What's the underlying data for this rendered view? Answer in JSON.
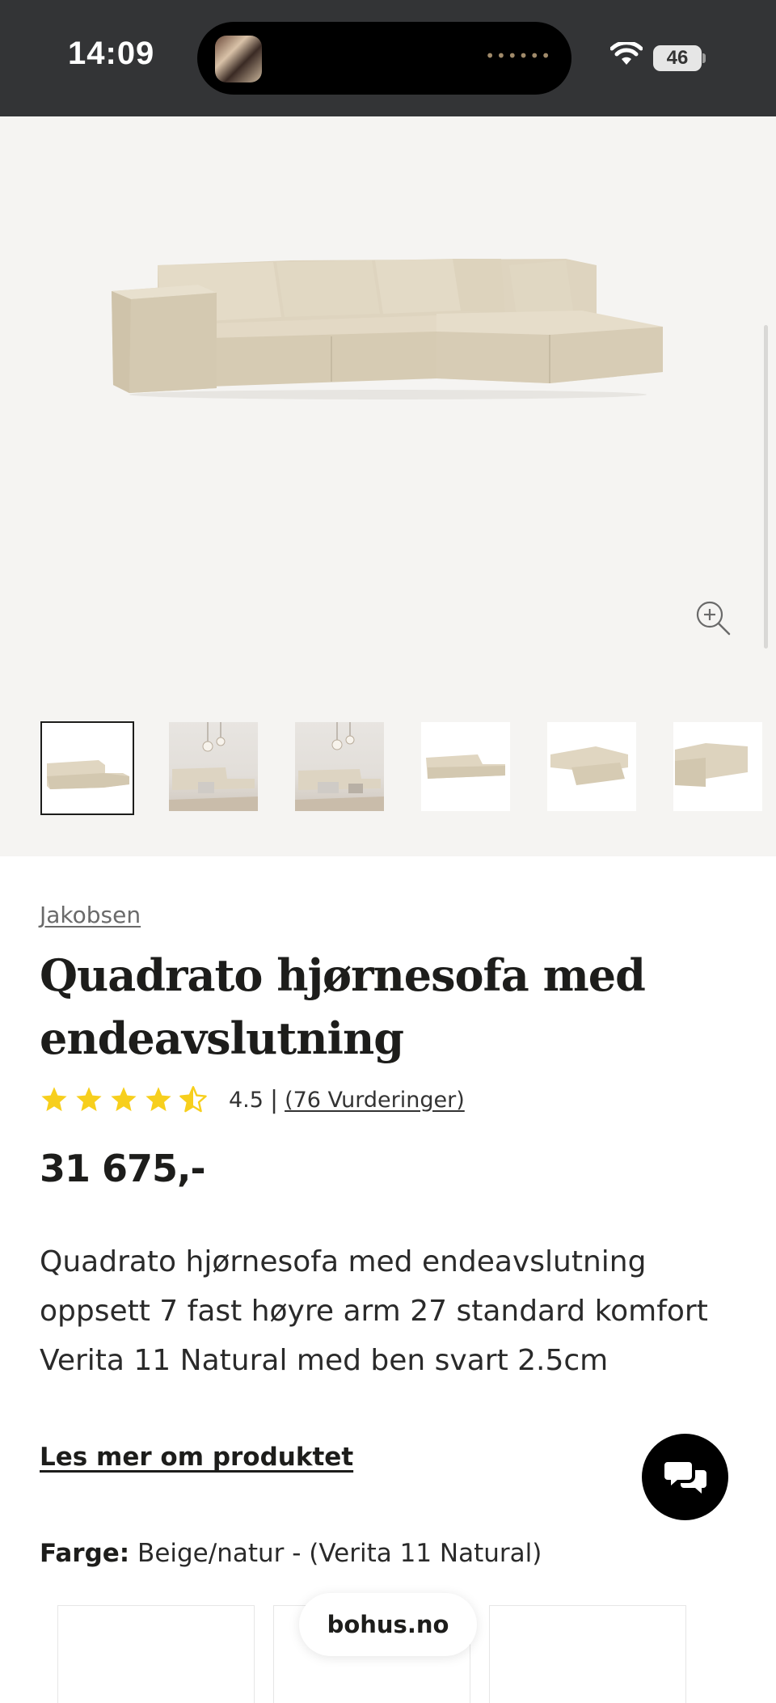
{
  "status_bar": {
    "time": "14:09",
    "battery": "46",
    "wifi_icon": "wifi-icon"
  },
  "gallery": {
    "zoom_icon": "zoom-in-icon",
    "thumbnails": [
      {
        "label": "sofa-white-background",
        "active": true
      },
      {
        "label": "sofa-living-room-1",
        "active": false
      },
      {
        "label": "sofa-living-room-2",
        "active": false
      },
      {
        "label": "sofa-front-view",
        "active": false
      },
      {
        "label": "sofa-angled-view",
        "active": false
      },
      {
        "label": "sofa-side-view",
        "active": false
      }
    ]
  },
  "product": {
    "brand": "Jakobsen",
    "title": "Quadrato hjørnesofa med endeavslutning",
    "rating": {
      "value": "4.5",
      "stars": 4.5,
      "separator": "|",
      "reviews_link": "(76 Vurderinger)"
    },
    "price": "31 675,-",
    "description": "Quadrato hjørnesofa med endeavslutning oppsett 7 fast høyre arm 27 standard komfort Verita 11 Natural med ben svart 2.5cm",
    "read_more": "Les mer om produktet",
    "color_label": "Farge:",
    "color_value": "Beige/natur - (Verita 11 Natural)"
  },
  "chat_icon": "chat-bubbles-icon",
  "browser": {
    "url": "bohus.no"
  },
  "colors": {
    "status_bar_bg": "#333436",
    "gallery_bg": "#f5f4f2",
    "star": "#f7cf1d",
    "text": "#1d1d1b",
    "sofa": "#e2d9c5"
  }
}
